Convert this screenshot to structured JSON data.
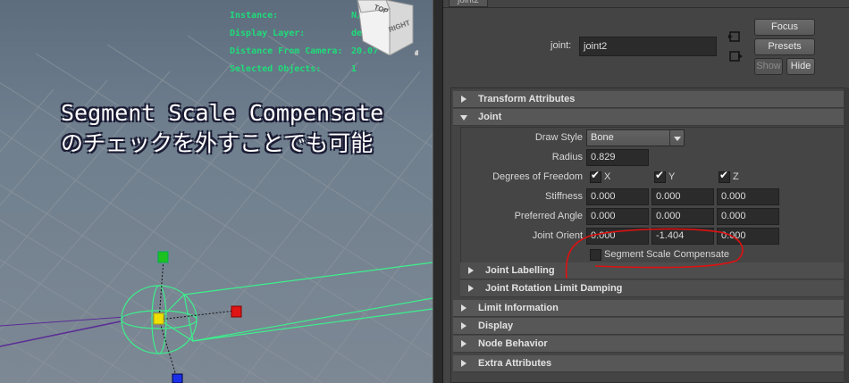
{
  "viewport": {
    "hud": [
      {
        "key": "Instance:",
        "value": "N/A"
      },
      {
        "key": "Display Layer:",
        "value": "default"
      },
      {
        "key": "Distance From Camera:",
        "value": "20.07"
      },
      {
        "key": "Selected Objects:",
        "value": "1"
      }
    ],
    "viewcube": {
      "top": "TOP",
      "right": "RIGHT"
    },
    "overlay_lines": [
      "Segment Scale Compensate",
      "のチェックを外すことでも可能"
    ]
  },
  "editor": {
    "tab_label": "joint2",
    "node_label": "joint:",
    "node_name": "joint2",
    "buttons": {
      "focus": "Focus",
      "presets": "Presets",
      "show": "Show",
      "hide": "Hide"
    },
    "sections_top": [
      {
        "label": "Transform Attributes",
        "expanded": false
      },
      {
        "label": "Joint",
        "expanded": true
      }
    ],
    "joint": {
      "draw_style_label": "Draw Style",
      "draw_style_value": "Bone",
      "radius_label": "Radius",
      "radius_value": "0.829",
      "dof_label": "Degrees of Freedom",
      "dof": [
        {
          "axis": "X",
          "checked": true
        },
        {
          "axis": "Y",
          "checked": true
        },
        {
          "axis": "Z",
          "checked": true
        }
      ],
      "stiffness_label": "Stiffness",
      "stiffness": [
        "0.000",
        "0.000",
        "0.000"
      ],
      "preferred_angle_label": "Preferred Angle",
      "preferred_angle": [
        "0.000",
        "0.000",
        "0.000"
      ],
      "joint_orient_label": "Joint Orient",
      "joint_orient": [
        "0.000",
        "-1.404",
        "0.000"
      ],
      "ssc_label": "Segment Scale Compensate",
      "ssc_checked": false
    },
    "sub_sections": [
      {
        "label": "Joint Labelling"
      },
      {
        "label": "Joint Rotation Limit Damping"
      }
    ],
    "sections_bottom": [
      {
        "label": "Limit Information"
      },
      {
        "label": "Display"
      },
      {
        "label": "Node Behavior"
      },
      {
        "label": "Extra Attributes"
      }
    ],
    "colors": {
      "hud_green": "#1fdc7a",
      "annotation_red": "#e01010",
      "wire_green": "#3cf08c"
    }
  }
}
